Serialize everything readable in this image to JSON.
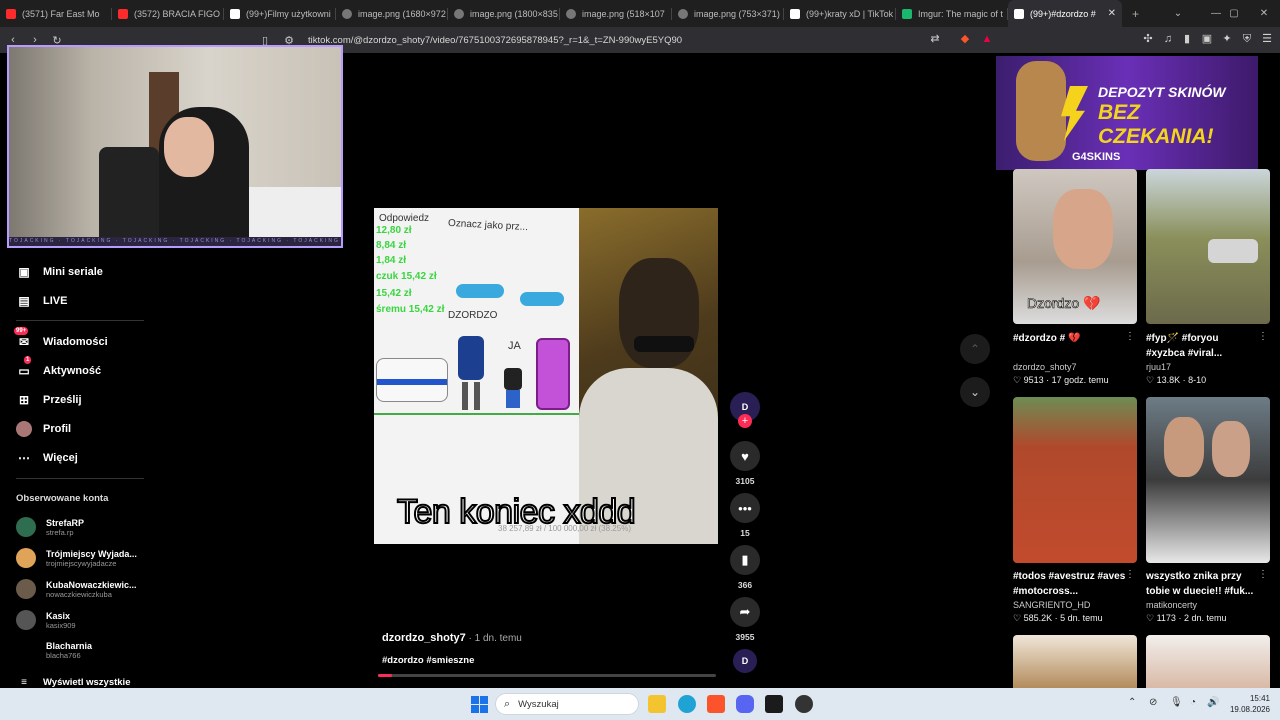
{
  "browser": {
    "tabs": [
      {
        "title": "(3571) Far East Mo",
        "color": "#ff2a2a"
      },
      {
        "title": "(3572) BRACIA FIGO F",
        "color": "#ff2a2a"
      },
      {
        "title": "(99+)Filmy użytkowni",
        "color": "#ffffff"
      },
      {
        "title": "image.png (1680×972",
        "color": "#888888"
      },
      {
        "title": "image.png (1800×835",
        "color": "#888888"
      },
      {
        "title": "image.png (518×107",
        "color": "#888888"
      },
      {
        "title": "image.png (753×371)",
        "color": "#888888"
      },
      {
        "title": "(99+)kraty xD | TikTok",
        "color": "#ffffff"
      },
      {
        "title": "Imgur: The magic of t",
        "color": "#1bb76e"
      }
    ],
    "active_tab": {
      "title": "(99+)#dzordzo #",
      "close": "✕"
    },
    "new_tab": "+",
    "url": "tiktok.com/@dzordzo_shoty7/video/7675100372695878945?_r=1&_t=ZN-990wyE5YQ90"
  },
  "sidebar": {
    "nav": [
      {
        "label": "Mini seriale",
        "icon": "mini-series-icon",
        "glyph": "▣"
      },
      {
        "label": "LIVE",
        "icon": "live-icon",
        "glyph": "▤"
      },
      {
        "label": "Wiadomości",
        "icon": "messages-icon",
        "glyph": "✉",
        "badge": "99+"
      },
      {
        "label": "Aktywność",
        "icon": "activity-icon",
        "glyph": "▭",
        "badge": "1"
      },
      {
        "label": "Prześlij",
        "icon": "upload-icon",
        "glyph": "⊞"
      },
      {
        "label": "Profil",
        "icon": "profile-icon",
        "glyph": "●"
      },
      {
        "label": "Więcej",
        "icon": "more-icon",
        "glyph": "⋯"
      }
    ],
    "followed_title": "Obserwowane konta",
    "accounts": [
      {
        "name": "StrefaRP",
        "handle": "strefa.rp",
        "color": "#2e6d4f"
      },
      {
        "name": "Trójmiejscy Wyjada...",
        "handle": "trojmiejscywyjadacze",
        "color": "#e0a458"
      },
      {
        "name": "KubaNowaczkiewic...",
        "handle": "nowaczkiewiczkuba",
        "color": "#6b5b4a"
      },
      {
        "name": "Kasix",
        "handle": "kasix909",
        "color": "#555555"
      },
      {
        "name": "Blacharnia",
        "handle": "blacha766",
        "color": "#000000"
      }
    ],
    "show_all": "Wyświetl wszystkie"
  },
  "video": {
    "overlay": {
      "reply": "Odpowiedz",
      "mark": "Oznacz jako prz...",
      "money_lines": [
        "12,80 zł",
        "8,84 zł",
        "1,84 zł",
        "czuk 15,42 zł",
        "15,42 zł",
        "śremu 15,42 zł"
      ],
      "drawing_label": "DZORDZO",
      "ja_label": "JA",
      "progress_text": "38 257,89 zł / 100 000,00 zł (38.25%)"
    },
    "caption": "Ten koniec xddd",
    "author": "dzordzo_shoty7",
    "posted": " · 1 dn. temu",
    "tags": "#dzordzo #smieszne",
    "progress": 0.04
  },
  "actions": {
    "likes": "3105",
    "comments": "15",
    "saves": "366",
    "shares": "3955"
  },
  "ad": {
    "line1": "DEPOZYT SKINÓW",
    "line2": "BEZ CZEKANIA!",
    "brand": "G4SKINS"
  },
  "recommended": [
    {
      "title": "#dzordzo # 💔",
      "user": "dzordzo_shoty7",
      "views": "9513",
      "ago": "17 godz. temu",
      "thumb_text": "Dzordzo 💔"
    },
    {
      "title": "#fyp🪄 #foryou #xyzbca #viral...",
      "user": "rjuu17",
      "views": "13.8K",
      "ago": "8-10",
      "thumb_text": ""
    },
    {
      "title": "#todos #avestruz #aves #motocross...",
      "user": "SANGRIENTO_HD",
      "views": "585.2K",
      "ago": "5 dn. temu",
      "thumb_text": ""
    },
    {
      "title": "wszystko znika przy tobie w duecie!! #fuk...",
      "user": "matikoncerty",
      "views": "1173",
      "ago": "2 dn. temu",
      "thumb_text": ""
    }
  ],
  "taskbar": {
    "search_placeholder": "Wyszukaj",
    "time": "15:41",
    "date": "19.08.2026"
  }
}
